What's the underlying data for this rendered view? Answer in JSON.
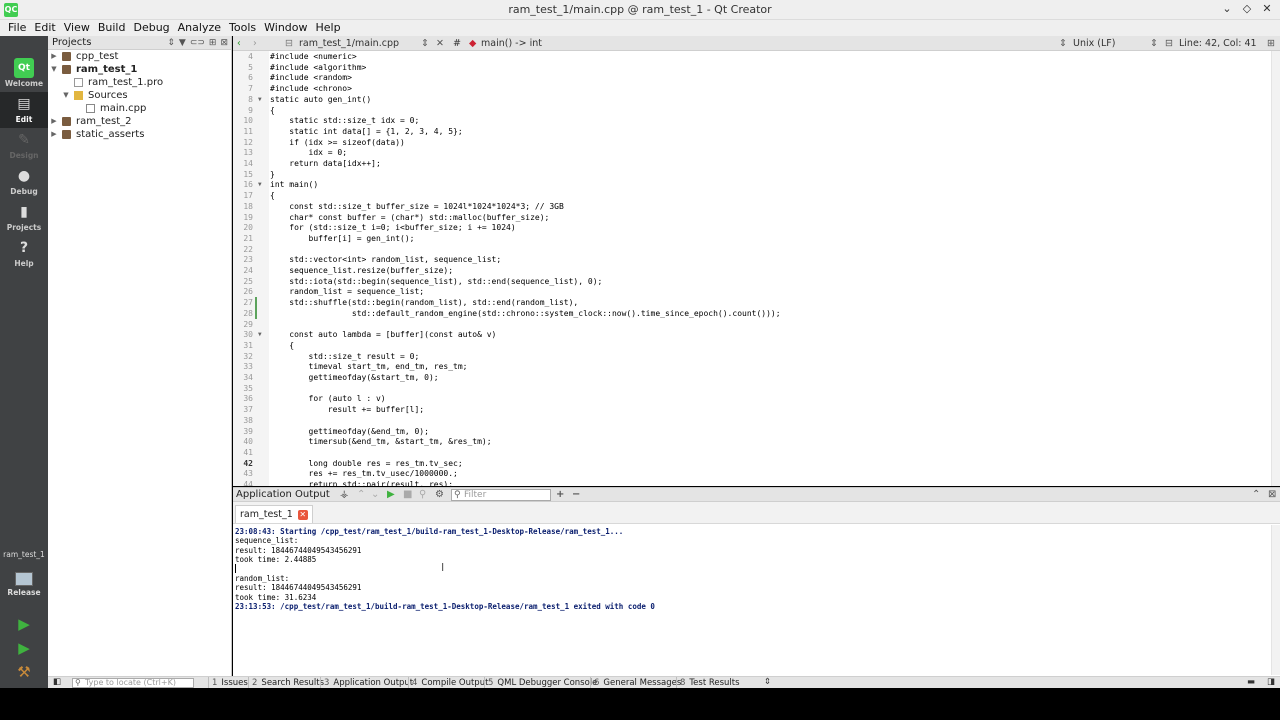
{
  "window": {
    "title": "ram_test_1/main.cpp @ ram_test_1 - Qt Creator",
    "app_icon_text": "QC",
    "controls": [
      "⌄",
      "◇",
      "✕"
    ]
  },
  "menu": [
    "File",
    "Edit",
    "View",
    "Build",
    "Debug",
    "Analyze",
    "Tools",
    "Window",
    "Help"
  ],
  "modes": [
    {
      "label": "Welcome",
      "icon": "qt-logo-icon"
    },
    {
      "label": "Edit",
      "icon": "edit-icon"
    },
    {
      "label": "Design",
      "icon": "design-icon"
    },
    {
      "label": "Debug",
      "icon": "debug-icon"
    },
    {
      "label": "Projects",
      "icon": "projects-icon"
    },
    {
      "label": "Help",
      "icon": "help-icon"
    }
  ],
  "kit": {
    "project": "ram_test_1",
    "build": "Release"
  },
  "projects_pane": {
    "title": "Projects",
    "tree": [
      {
        "label": "cpp_test",
        "level": 0,
        "arrow": "▶",
        "icon": "project",
        "bold": false
      },
      {
        "label": "ram_test_1",
        "level": 0,
        "arrow": "▼",
        "icon": "project",
        "bold": true
      },
      {
        "label": "ram_test_1.pro",
        "level": 1,
        "arrow": "",
        "icon": "pro",
        "bold": false
      },
      {
        "label": "Sources",
        "level": 1,
        "arrow": "▼",
        "icon": "folder",
        "bold": false
      },
      {
        "label": "main.cpp",
        "level": 2,
        "arrow": "",
        "icon": "cpp",
        "bold": false
      },
      {
        "label": "ram_test_2",
        "level": 0,
        "arrow": "▶",
        "icon": "project",
        "bold": false
      },
      {
        "label": "static_asserts",
        "level": 0,
        "arrow": "▶",
        "icon": "project",
        "bold": false
      }
    ]
  },
  "editor_toolbar": {
    "file": "ram_test_1/main.cpp",
    "hash": "#",
    "symbol": "main() -> int",
    "line_ending": "Unix (LF)",
    "position": "Line: 42, Col: 41"
  },
  "code": [
    {
      "n": "4",
      "t": "#include <numeric>"
    },
    {
      "n": "5",
      "t": "#include <algorithm>"
    },
    {
      "n": "6",
      "t": "#include <random>"
    },
    {
      "n": "7",
      "t": "#include <chrono>"
    },
    {
      "n": "8",
      "t": "static auto gen_int()",
      "fold": true
    },
    {
      "n": "9",
      "t": "{"
    },
    {
      "n": "10",
      "t": "    static std::size_t idx = 0;"
    },
    {
      "n": "11",
      "t": "    static int data[] = {1, 2, 3, 4, 5};"
    },
    {
      "n": "12",
      "t": "    if (idx >= sizeof(data))"
    },
    {
      "n": "13",
      "t": "        idx = 0;"
    },
    {
      "n": "14",
      "t": "    return data[idx++];"
    },
    {
      "n": "15",
      "t": "}"
    },
    {
      "n": "16",
      "t": "int main()",
      "fold": true
    },
    {
      "n": "17",
      "t": "{"
    },
    {
      "n": "18",
      "t": "    const std::size_t buffer_size = 1024l*1024*1024*3; // 3GB"
    },
    {
      "n": "19",
      "t": "    char* const buffer = (char*) std::malloc(buffer_size);"
    },
    {
      "n": "20",
      "t": "    for (std::size_t i=0; i<buffer_size; i += 1024)"
    },
    {
      "n": "21",
      "t": "        buffer[i] = gen_int();"
    },
    {
      "n": "22",
      "t": ""
    },
    {
      "n": "23",
      "t": "    std::vector<int> random_list, sequence_list;"
    },
    {
      "n": "24",
      "t": "    sequence_list.resize(buffer_size);"
    },
    {
      "n": "25",
      "t": "    std::iota(std::begin(sequence_list), std::end(sequence_list), 0);"
    },
    {
      "n": "26",
      "t": "    random_list = sequence_list;"
    },
    {
      "n": "27",
      "t": "    std::shuffle(std::begin(random_list), std::end(random_list),"
    },
    {
      "n": "28",
      "t": "                 std::default_random_engine(std::chrono::system_clock::now().time_since_epoch().count()));"
    },
    {
      "n": "29",
      "t": ""
    },
    {
      "n": "30",
      "t": "    const auto lambda = [buffer](const auto& v)",
      "fold": true
    },
    {
      "n": "31",
      "t": "    {"
    },
    {
      "n": "32",
      "t": "        std::size_t result = 0;"
    },
    {
      "n": "33",
      "t": "        timeval start_tm, end_tm, res_tm;"
    },
    {
      "n": "34",
      "t": "        gettimeofday(&start_tm, 0);"
    },
    {
      "n": "35",
      "t": ""
    },
    {
      "n": "36",
      "t": "        for (auto l : v)"
    },
    {
      "n": "37",
      "t": "            result += buffer[l];"
    },
    {
      "n": "38",
      "t": ""
    },
    {
      "n": "39",
      "t": "        gettimeofday(&end_tm, 0);"
    },
    {
      "n": "40",
      "t": "        timersub(&end_tm, &start_tm, &res_tm);"
    },
    {
      "n": "41",
      "t": ""
    },
    {
      "n": "42",
      "t": "        long double res = res_tm.tv_sec;",
      "current": true
    },
    {
      "n": "43",
      "t": "        res += res_tm.tv_usec/1000000.;"
    },
    {
      "n": "44",
      "t": "        return std::pair(result, res);"
    }
  ],
  "output_pane": {
    "title": "Application Output",
    "filter_placeholder": "Filter",
    "tab_label": "ram_test_1",
    "lines": [
      {
        "t": "23:08:43: Starting /cpp_test/ram_test_1/build-ram_test_1-Desktop-Release/ram_test_1...",
        "sys": true
      },
      {
        "t": "sequence_list:",
        "sys": false
      },
      {
        "t": "result: 18446744049543456291",
        "sys": false
      },
      {
        "t": "took time: 2.44885",
        "sys": false
      },
      {
        "t": "",
        "sys": false
      },
      {
        "t": "random_list:",
        "sys": false
      },
      {
        "t": "result: 18446744049543456291",
        "sys": false
      },
      {
        "t": "took time: 31.6234",
        "sys": false
      },
      {
        "t": "23:13:53: /cpp_test/ram_test_1/build-ram_test_1-Desktop-Release/ram_test_1 exited with code 0",
        "sys": true
      }
    ]
  },
  "statusbar": {
    "locator_placeholder": "Type to locate (Ctrl+K)",
    "panes": [
      {
        "num": "1",
        "label": "Issues"
      },
      {
        "num": "2",
        "label": "Search Results"
      },
      {
        "num": "3",
        "label": "Application Output"
      },
      {
        "num": "4",
        "label": "Compile Output"
      },
      {
        "num": "5",
        "label": "QML Debugger Console"
      },
      {
        "num": "6",
        "label": "General Messages"
      },
      {
        "num": "8",
        "label": "Test Results"
      }
    ]
  },
  "colors": {
    "run_green": "#3fb23f",
    "sidebar": "#404244",
    "output_sys": "#0a1e6e"
  }
}
